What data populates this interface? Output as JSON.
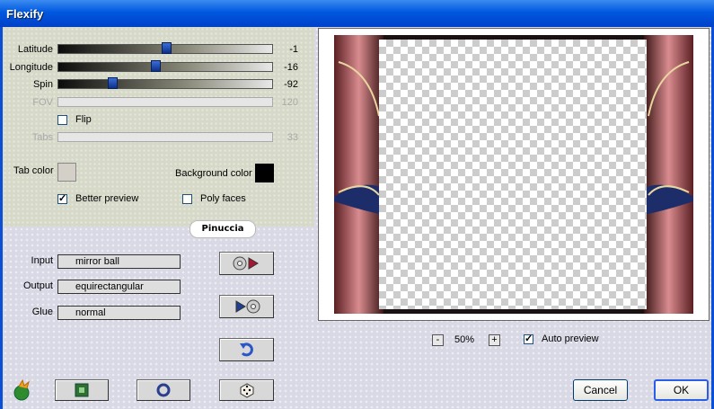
{
  "window": {
    "title": "Flexify"
  },
  "sliders": [
    {
      "label": "Latitude",
      "value": "-1",
      "fraction": 0.5,
      "enabled": true
    },
    {
      "label": "Longitude",
      "value": "-16",
      "fraction": 0.45,
      "enabled": true
    },
    {
      "label": "Spin",
      "value": "-92",
      "fraction": 0.24,
      "enabled": true
    },
    {
      "label": "FOV",
      "value": "120",
      "enabled": false
    },
    {
      "label": "Tabs",
      "value": "33",
      "enabled": false
    }
  ],
  "flip": {
    "label": "Flip",
    "checked": false
  },
  "tab_color": {
    "label": "Tab color",
    "color": "#d4d0c8"
  },
  "background_color": {
    "label": "Background color",
    "color": "#000000"
  },
  "better_preview": {
    "label": "Better preview",
    "checked": true
  },
  "poly_faces": {
    "label": "Poly faces",
    "checked": false
  },
  "watermark": "Pinuccia",
  "input": {
    "label": "Input",
    "value": "mirror ball"
  },
  "output": {
    "label": "Output",
    "value": "equirectangular"
  },
  "glue": {
    "label": "Glue",
    "value": "normal"
  },
  "zoom": {
    "minus": "-",
    "value": "50%",
    "plus": "+"
  },
  "auto_preview": {
    "label": "Auto preview",
    "checked": true
  },
  "buttons": {
    "cancel": "Cancel",
    "ok": "OK"
  },
  "check_mark": "✓"
}
